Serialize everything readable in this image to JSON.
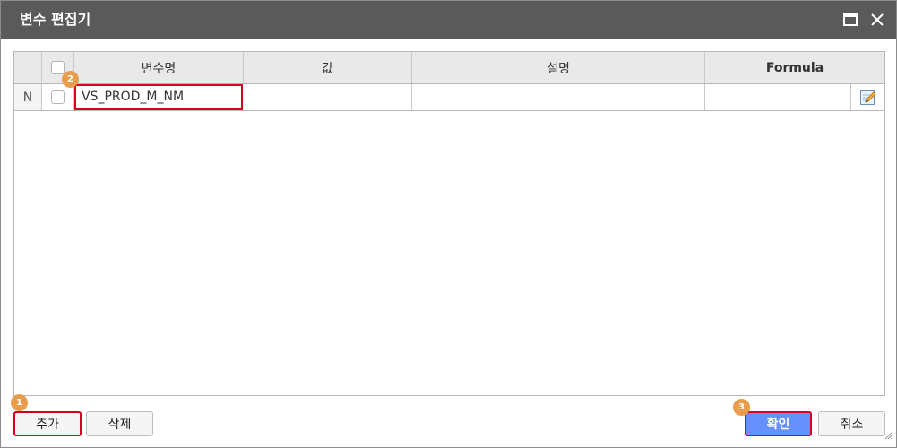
{
  "dialog": {
    "title": "변수 편집기",
    "maximize_icon": "maximize-icon",
    "close_icon": "close-icon"
  },
  "grid": {
    "columns": [
      "",
      "",
      "변수명",
      "값",
      "설명",
      "Formula"
    ],
    "rows": [
      {
        "row_state": "N",
        "checked": false,
        "name": "VS_PROD_M_NM",
        "value": "",
        "description": "",
        "formula": "",
        "formula_icon": "edit-icon"
      }
    ]
  },
  "buttons": {
    "add": "추가",
    "delete": "삭제",
    "confirm": "확인",
    "cancel": "취소"
  },
  "callouts": [
    "1",
    "2",
    "3"
  ],
  "colors": {
    "titlebar": "#5a5a5a",
    "header_bg": "#e9e9e9",
    "highlight": "#d9001b",
    "primary_button": "#6690ff",
    "callout": "#e89c4c"
  }
}
